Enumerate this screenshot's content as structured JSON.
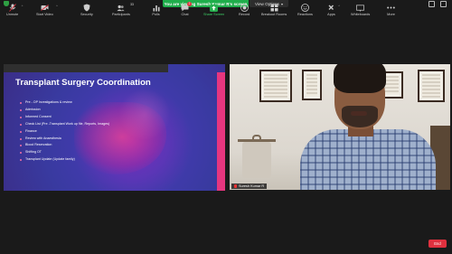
{
  "top_bar": {
    "share_banner": "You are viewing Suresh Kumar R's screen",
    "view_options": "View Options"
  },
  "slide": {
    "title": "Transplant Surgery Coordination",
    "bullets": [
      "Pre - OP Investigations & review",
      "Admission",
      "Informed Consent",
      "Check List (Pre -Transplant Work up file, Reports, Images)",
      "Finance",
      "Review with Anaesthesia",
      "Blood Reservation",
      "Shifting OT",
      "Transplant Update (Update family)"
    ]
  },
  "video": {
    "participant_name": "Suresh Kumar R"
  },
  "toolbar": {
    "items": [
      {
        "label": "Unmute",
        "icon": "microphone-muted-icon"
      },
      {
        "label": "Start Video",
        "icon": "video-off-icon"
      },
      {
        "label": "Security",
        "icon": "shield-icon"
      },
      {
        "label": "Participants",
        "icon": "participants-icon",
        "count": "33"
      },
      {
        "label": "Polls",
        "icon": "polls-icon"
      },
      {
        "label": "Chat",
        "icon": "chat-icon",
        "badge": "2"
      },
      {
        "label": "Share Screen",
        "icon": "share-screen-icon"
      },
      {
        "label": "Record",
        "icon": "record-icon"
      },
      {
        "label": "Breakout Rooms",
        "icon": "breakout-rooms-icon"
      },
      {
        "label": "Reactions",
        "icon": "reactions-icon"
      },
      {
        "label": "Apps",
        "icon": "apps-icon"
      },
      {
        "label": "Whiteboards",
        "icon": "whiteboard-icon"
      },
      {
        "label": "More",
        "icon": "more-icon"
      }
    ],
    "end_label": "End"
  }
}
